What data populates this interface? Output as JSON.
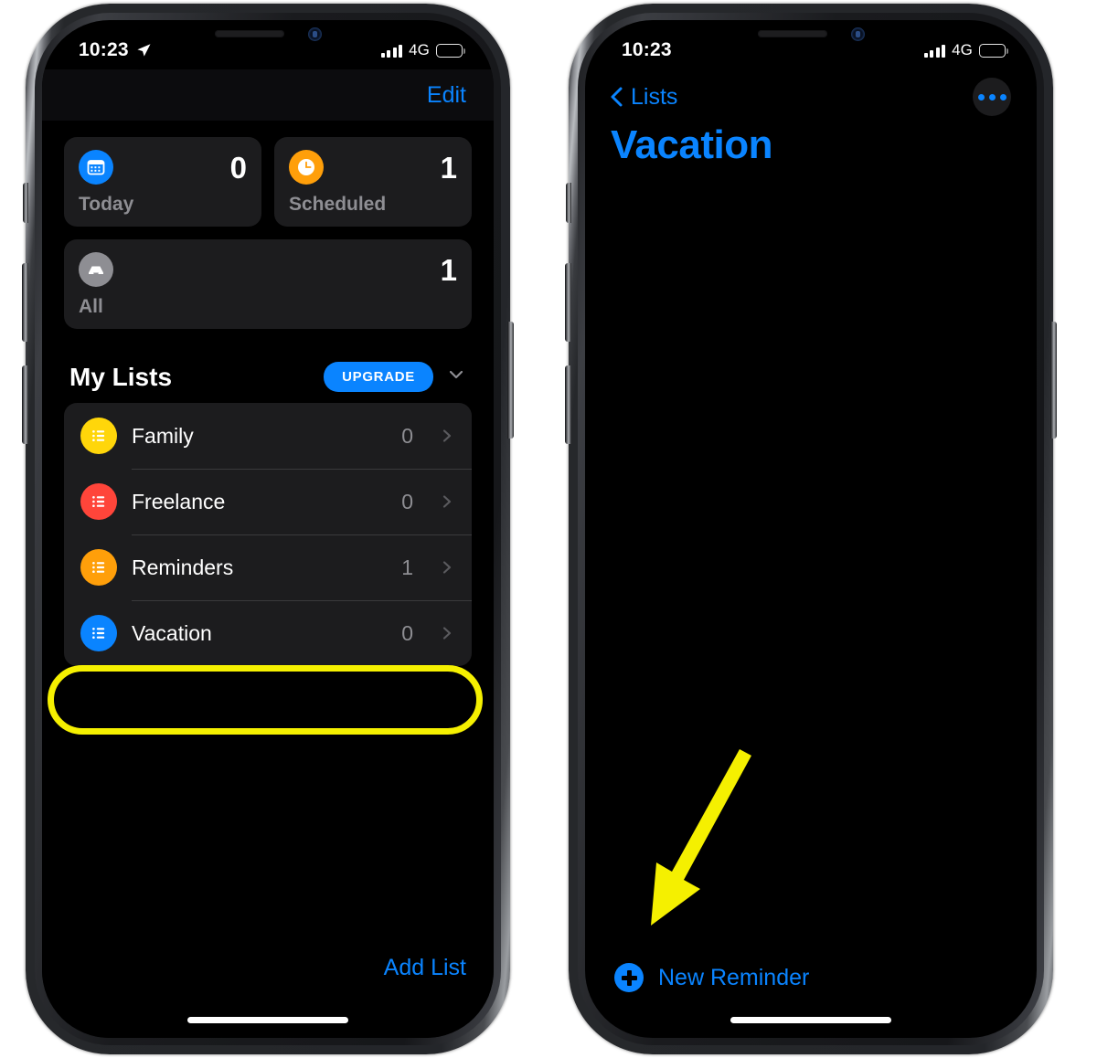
{
  "app": {
    "name": "Reminders",
    "platform": "iOS",
    "theme": "dark"
  },
  "annotation": {
    "highlight_color": "#F5F000",
    "highlight_target": "Vacation",
    "arrow_color": "#F5F000",
    "arrow_target": "New Reminder"
  },
  "phones": {
    "left": {
      "status_bar": {
        "time": "10:23",
        "location_icon": "location-arrow-icon",
        "signal_icon": "cellular-bars-icon",
        "network": "4G",
        "battery_icon": "battery-full-icon"
      },
      "nav": {
        "edit_label": "Edit"
      },
      "summary_cards": [
        {
          "icon": "calendar-icon",
          "icon_color": "#0A84FF",
          "count": "0",
          "label": "Today"
        },
        {
          "icon": "clock-icon",
          "icon_color": "#FF9F0A",
          "count": "1",
          "label": "Scheduled"
        },
        {
          "icon": "inbox-tray-icon",
          "icon_color": "#8E8E93",
          "count": "1",
          "label": "All"
        }
      ],
      "section": {
        "title": "My Lists",
        "upgrade_label": "UPGRADE",
        "upgrade_color": "#0A84FF",
        "collapse_icon": "chevron-down-icon"
      },
      "lists": [
        {
          "name": "Family",
          "count": "0",
          "color": "#FFD60A",
          "icon": "list-bullet-icon"
        },
        {
          "name": "Freelance",
          "count": "0",
          "color": "#FF453A",
          "icon": "list-bullet-icon"
        },
        {
          "name": "Reminders",
          "count": "1",
          "color": "#FF9F0A",
          "icon": "list-bullet-icon"
        },
        {
          "name": "Vacation",
          "count": "0",
          "color": "#0A84FF",
          "icon": "list-bullet-icon"
        }
      ],
      "add_list_label": "Add List"
    },
    "right": {
      "status_bar": {
        "time": "10:23",
        "signal_icon": "cellular-bars-icon",
        "network": "4G",
        "battery_icon": "battery-full-icon"
      },
      "nav": {
        "back_label": "Lists",
        "back_icon": "chevron-left-icon",
        "more_icon": "ellipsis-icon"
      },
      "title": "Vacation",
      "title_color": "#0A84FF",
      "empty_state": "",
      "new_reminder": {
        "label": "New Reminder",
        "icon": "plus-circle-icon"
      }
    }
  }
}
